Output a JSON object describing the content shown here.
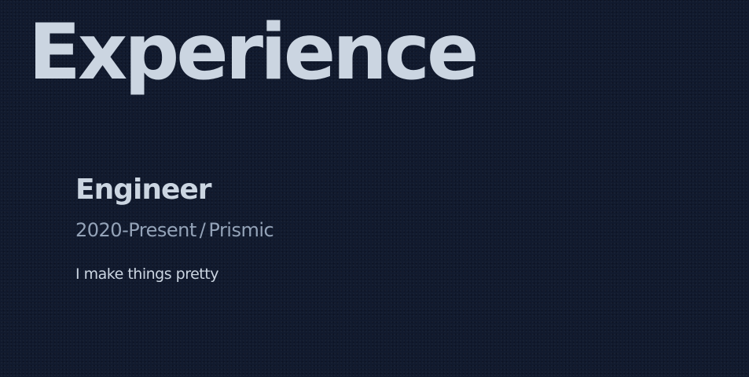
{
  "section": {
    "title": "Experience"
  },
  "experience": {
    "items": [
      {
        "title": "Engineer",
        "period": "2020-Present",
        "separator": "/",
        "company": "Prismic",
        "description": "I make things pretty"
      }
    ]
  },
  "colors": {
    "background": "#111a2e",
    "heading": "#cbd5e1",
    "muted": "#94a3b8"
  }
}
